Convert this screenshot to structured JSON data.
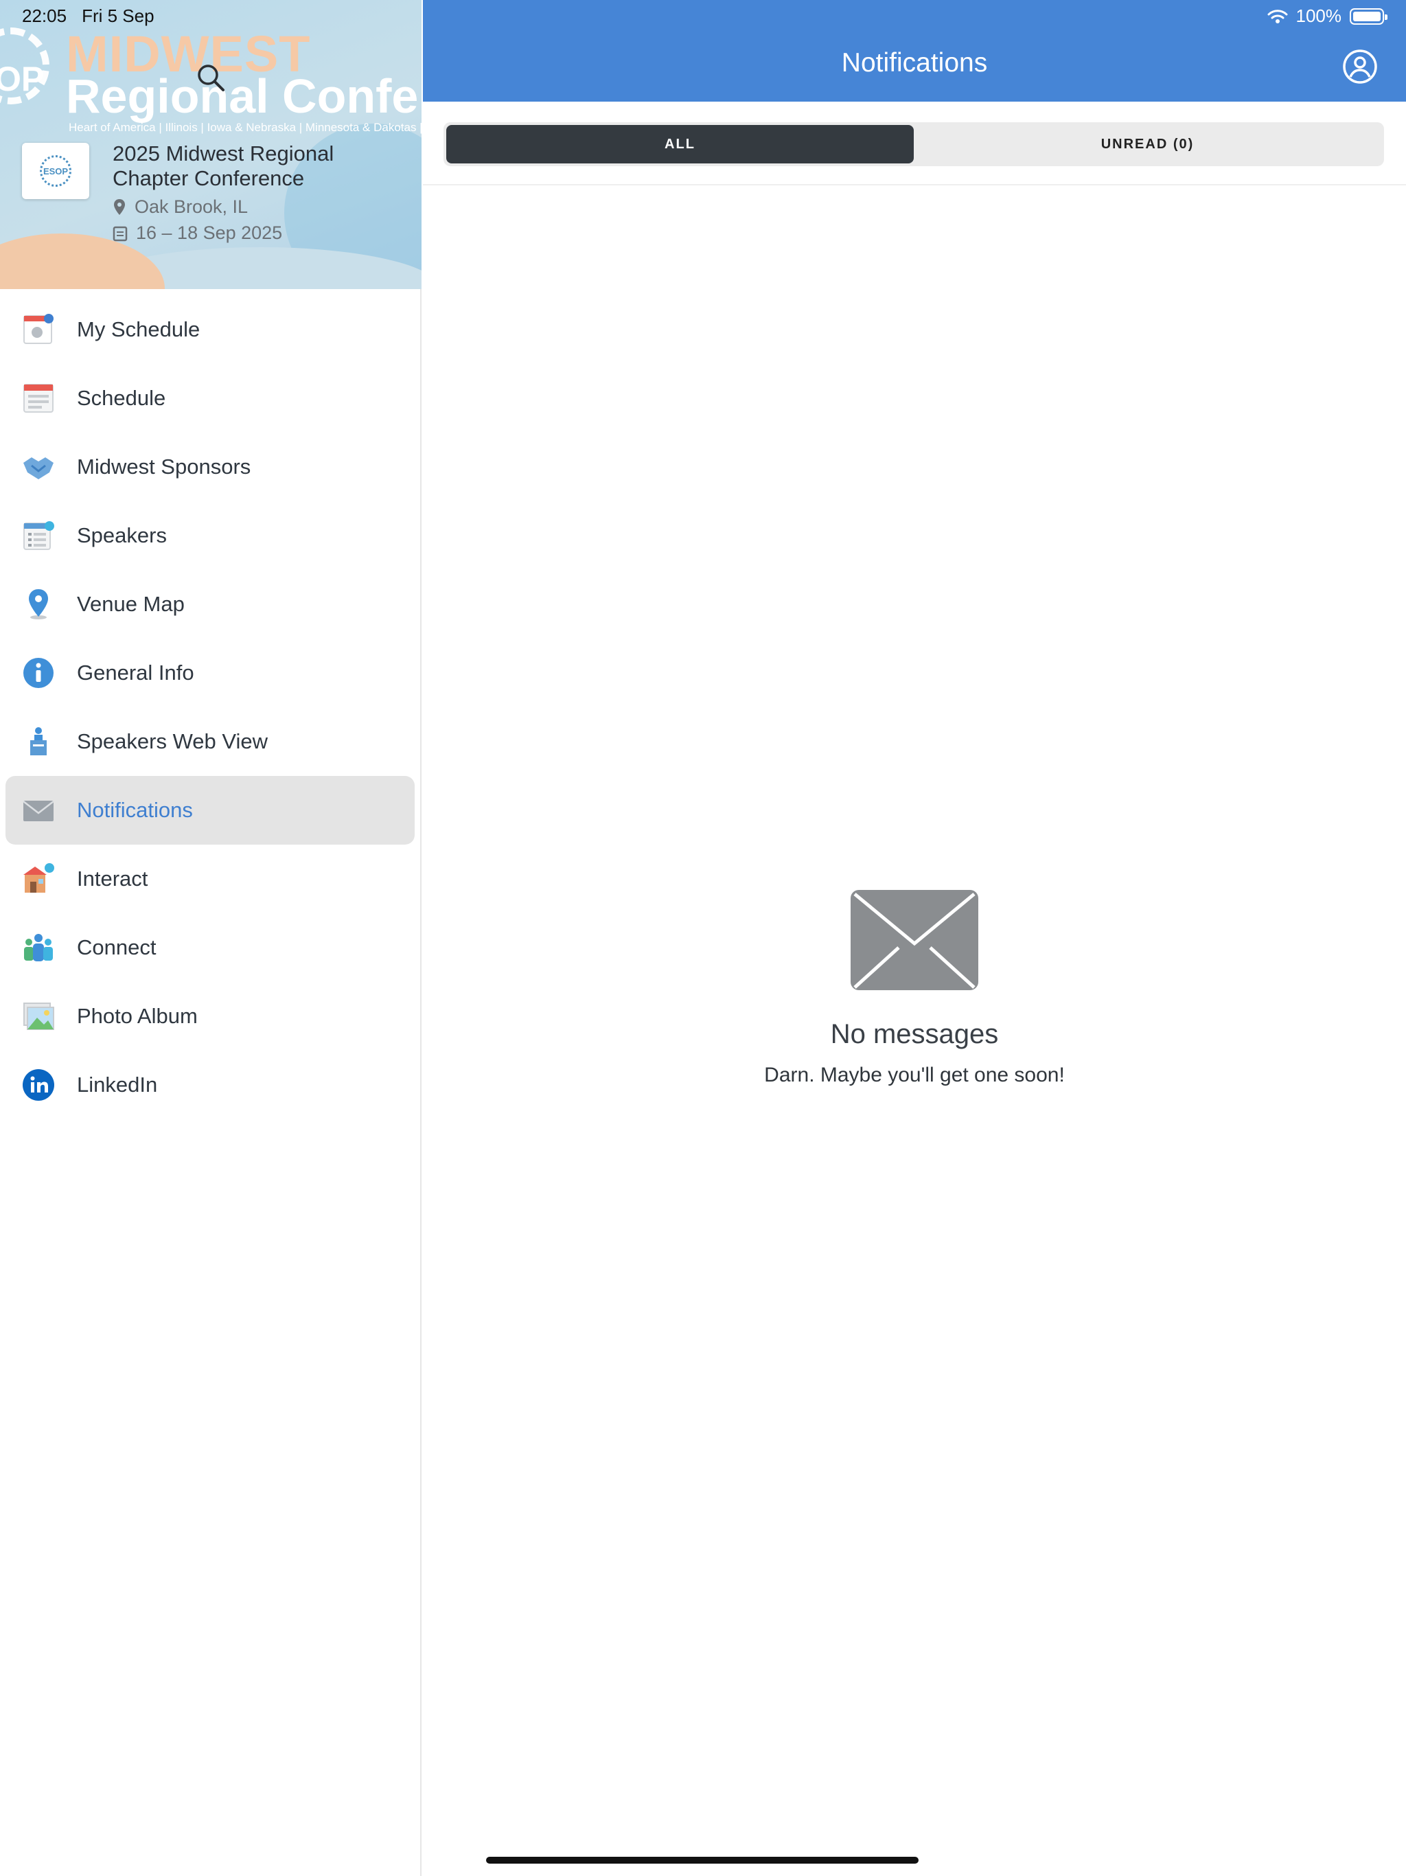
{
  "status_bar": {
    "time": "22:05",
    "date": "Fri 5 Sep",
    "battery": "100%"
  },
  "banner": {
    "line1": "MIDWEST",
    "line2": "Regional Conferen",
    "tagline": "Heart of America | Illinois | Iowa & Nebraska | Minnesota & Dakotas |",
    "logo_text": "OP",
    "badge_text": "ESOP"
  },
  "event": {
    "title": "2025 Midwest Regional Chapter Conference",
    "location": "Oak Brook, IL",
    "dates": "16 – 18 Sep 2025"
  },
  "sidebar": {
    "items": [
      {
        "label": "My Schedule",
        "icon": "my-schedule-icon"
      },
      {
        "label": "Schedule",
        "icon": "calendar-icon"
      },
      {
        "label": "Midwest Sponsors",
        "icon": "handshake-icon"
      },
      {
        "label": "Speakers",
        "icon": "speakers-list-icon"
      },
      {
        "label": "Venue Map",
        "icon": "map-pin-icon"
      },
      {
        "label": "General Info",
        "icon": "info-icon"
      },
      {
        "label": "Speakers Web View",
        "icon": "podium-icon"
      },
      {
        "label": "Notifications",
        "icon": "envelope-icon",
        "active": true
      },
      {
        "label": "Interact",
        "icon": "interact-icon"
      },
      {
        "label": "Connect",
        "icon": "people-icon"
      },
      {
        "label": "Photo Album",
        "icon": "photo-icon"
      },
      {
        "label": "LinkedIn",
        "icon": "linkedin-icon"
      }
    ]
  },
  "header": {
    "title": "Notifications"
  },
  "tabs": [
    {
      "label": "ALL",
      "active": true
    },
    {
      "label": "UNREAD (0)",
      "active": false
    }
  ],
  "empty_state": {
    "title": "No messages",
    "subtitle": "Darn. Maybe you'll get one soon!"
  },
  "colors": {
    "header_blue": "#4685d6",
    "active_text": "#3f7fd0",
    "tab_active": "#343a40"
  }
}
